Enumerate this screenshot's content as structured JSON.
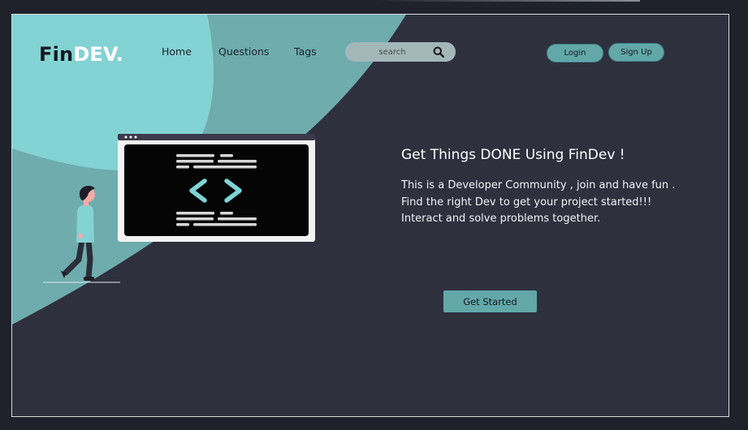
{
  "brand": {
    "part1": "Fin",
    "part2": "DEV."
  },
  "nav": {
    "home": "Home",
    "questions": "Questions",
    "tags": "Tags"
  },
  "search": {
    "placeholder": "search"
  },
  "auth": {
    "login": "Login",
    "signup": "Sign Up"
  },
  "hero": {
    "title": "Get Things DONE Using FinDev !",
    "lines": [
      "This is a Developer Community , join and have fun .",
      "Find the right Dev to get your project started!!!",
      "Interact and solve problems together."
    ],
    "cta": "Get Started"
  },
  "icons": {
    "search": "search-icon",
    "code": "code-brackets-icon"
  },
  "colors": {
    "page_bg": "#2f303e",
    "outer_bg": "#1f222b",
    "teal_dark": "#6eacad",
    "teal_light": "#83d2d4",
    "accent": "#62a8a9"
  }
}
